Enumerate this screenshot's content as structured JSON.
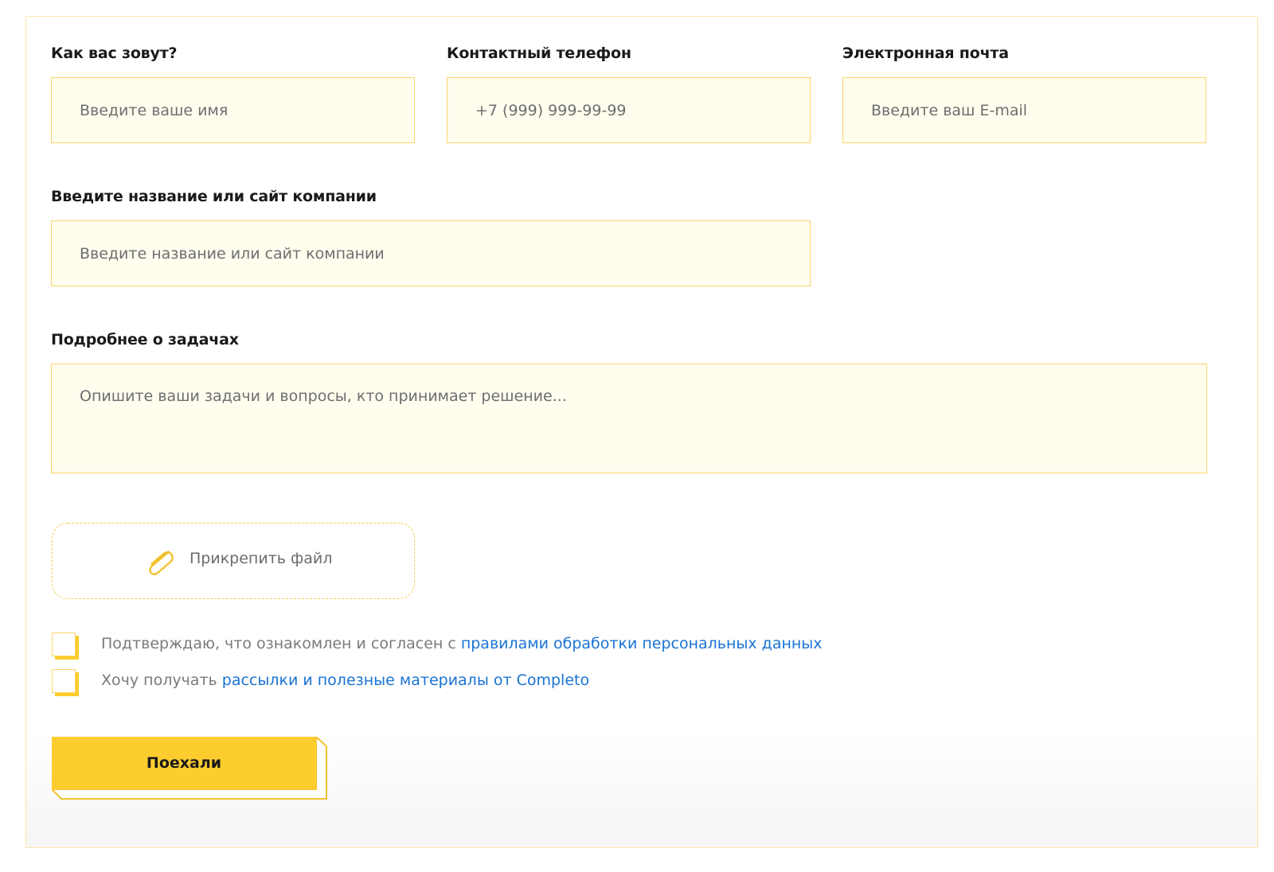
{
  "form": {
    "name": {
      "label": "Как вас зовут?",
      "placeholder": "Введите ваше имя",
      "value": ""
    },
    "phone": {
      "label": "Контактный телефон",
      "placeholder": "+7 (999) 999-99-99",
      "value": ""
    },
    "email": {
      "label": "Электронная почта",
      "placeholder": "Введите ваш E-mail",
      "value": ""
    },
    "company": {
      "label": "Введите название или сайт компании",
      "placeholder": "Введите название или сайт компании",
      "value": ""
    },
    "tasks": {
      "label": "Подробнее о задачах",
      "placeholder": "Опишите ваши задачи и вопросы, кто принимает решение...",
      "value": ""
    },
    "attach": {
      "label": "Прикрепить файл",
      "icon": "paperclip-icon"
    },
    "consent": {
      "text": "Подтверждаю, что ознакомлен и согласен с ",
      "link": "правилами обработки персональных данных",
      "checked": false
    },
    "newsletter": {
      "text": "Хочу получать ",
      "link": "рассылки и полезные материалы от Completo",
      "checked": false
    },
    "submit_label": "Поехали"
  },
  "colors": {
    "accent": "#fccc2b",
    "field_border": "#fcd56b",
    "field_background": "#fffdee",
    "link": "#1a73d4",
    "muted_text": "#7a7a7a"
  }
}
